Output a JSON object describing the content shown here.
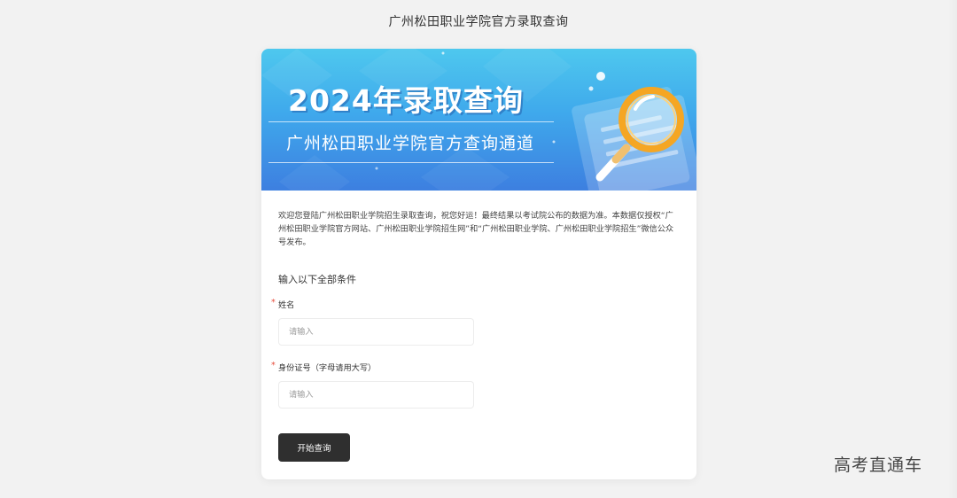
{
  "page": {
    "title": "广州松田职业学院官方录取查询"
  },
  "banner": {
    "heading": "2024年录取查询",
    "subheading": "广州松田职业学院官方查询通道",
    "icon": "magnifier-icon"
  },
  "intro": {
    "text": "欢迎您登陆广州松田职业学院招生录取查询，祝您好运！最终结果以考试院公布的数据为准。本数据仅授权“广州松田职业学院官方网站、广州松田职业学院招生网”和“广州松田职业学院、广州松田职业学院招生”微信公众号发布。"
  },
  "form": {
    "section_title": "输入以下全部条件",
    "required_mark": "*",
    "name_label": "姓名",
    "name_placeholder": "请输入",
    "name_value": "",
    "id_label": "身份证号（字母请用大写）",
    "id_placeholder": "请输入",
    "id_value": "",
    "submit_label": "开始查询"
  },
  "watermark": {
    "text": "高考直通车"
  },
  "colors": {
    "page_background": "#f2f2f2",
    "banner_top": "#4ec8ee",
    "banner_bottom": "#3d7fe0",
    "button": "#2f2f2f",
    "required": "#e74c3c",
    "magnifier_ring": "#f5a623"
  }
}
